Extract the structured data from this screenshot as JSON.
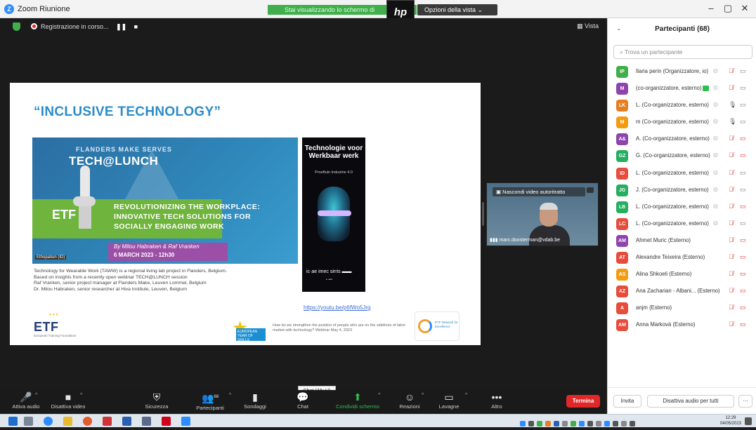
{
  "window": {
    "title": "Zoom Riunione",
    "share_banner": "Stai visualizzando lo schermo di",
    "view_options": "Opzioni della vista",
    "controls": [
      "–",
      "▢",
      "✕"
    ]
  },
  "meeting_top": {
    "recording": "Registrazione in corso...",
    "pause": "❚❚",
    "stop": "■",
    "view": "Vista"
  },
  "slide": {
    "title": "“INCLUSIVE TECHNOLOGY”",
    "banner_small": "FLANDERS MAKE SERVES",
    "banner_big": "TECH@LUNCH",
    "banner_headline": "REVOLUTIONIZING THE WORKPLACE: INNOVATIVE TECH SOLUTIONS FOR SOCIALLY ENGAGING WORK",
    "banner_authors": "By Milou Habraken & Raf Vranken",
    "banner_date": "6 MARCH 2023 - 12h30",
    "banner_tag": "Ethopation (ID)",
    "book_title": "Technologie voor Werkbaar werk",
    "book_sub": "Proeftuin Industrie 4.0",
    "book_logos": "ic·ae  imec  sirris  ▬▬",
    "link": "https://youtu.be/p6fWo5Jrg",
    "description": [
      "Technology for Wearable Work (TAWW) is a regional living lab project in Flanders, Belgium.",
      "Based on insights from a recently open webinar TECH@LUNCH session",
      "Raf Vranken, senior project manager at Flanders Make, Leuven Lommel, Belgium",
      "Dr. Milou Habraken, senior researcher at Hiva Institute, Leuven, Belgium"
    ],
    "etf": "ETF",
    "etf_sub": "European Training Foundation",
    "eys": "EUROPEAN YEAR OF SKILLS",
    "webinar": "How do we strengthen the position of people who are on the sidelines of labor market with technology? Webinar May 4, 2023",
    "network": "ETF Network for Excellence"
  },
  "camera": {
    "hide_label": "Nascondi video autoritratto",
    "participant_name": "marc.doosterman@vdab.be"
  },
  "tooltip": "Chat (Alt+H)",
  "toolbar": {
    "items": [
      {
        "label": "Attiva audio",
        "icon": "🎤"
      },
      {
        "label": "Disattiva video",
        "icon": "■"
      },
      {
        "label": "Sicurezza",
        "icon": "⛨"
      },
      {
        "label": "Partecipanti",
        "icon": "👥",
        "count": "68"
      },
      {
        "label": "Sondaggi",
        "icon": "▮"
      },
      {
        "label": "Chat",
        "icon": "💬"
      },
      {
        "label": "Condividi schermo",
        "icon": "⬆"
      },
      {
        "label": "Reazioni",
        "icon": "☺"
      },
      {
        "label": "Lavagne",
        "icon": "▭"
      },
      {
        "label": "Altro",
        "icon": "•••"
      }
    ],
    "end": "Termina"
  },
  "panel": {
    "title": "Partecipanti (68)",
    "search_placeholder": "Trova un partecipante",
    "participants": [
      {
        "initials": "IP",
        "color": "#3fae4b",
        "name": "Ilaria perin (Organizzatore, io)",
        "mic": "muted",
        "cam": "on"
      },
      {
        "initials": "M",
        "color": "#8e44ad",
        "name": "(co-organizzatore, esterno)",
        "mic": "muted",
        "cam": "on",
        "sharing": true
      },
      {
        "initials": "LK",
        "color": "#e67e22",
        "name": "L. (Co-organizzatore, esterno)",
        "mic": "on",
        "cam": "on"
      },
      {
        "initials": "M",
        "color": "#f39c12",
        "name": "m (Co-organizzatore, esterno)",
        "mic": "on",
        "cam": "on"
      },
      {
        "initials": "A&",
        "color": "#8e44ad",
        "name": "A. (Co-organizzatore, esterno)",
        "mic": "muted",
        "cam": "off"
      },
      {
        "initials": "GZ",
        "color": "#27ae60",
        "name": "G. (Co-organizzatore, esterno)",
        "mic": "muted",
        "cam": "off"
      },
      {
        "initials": "ID",
        "color": "#e74c3c",
        "name": "L. (Co-organizzatore, esterno)",
        "mic": "muted",
        "cam": "on"
      },
      {
        "initials": "JG",
        "color": "#27ae60",
        "name": "J. (Co-organizzatore, esterno)",
        "mic": "muted",
        "cam": "on"
      },
      {
        "initials": "LB",
        "color": "#27ae60",
        "name": "L. (Co-organizzatore, esterno)",
        "mic": "muted",
        "cam": "off"
      },
      {
        "initials": "LC",
        "color": "#e74c3c",
        "name": "L. (Co-organizzatore, esterno)",
        "mic": "muted",
        "cam": "on"
      },
      {
        "initials": "AM",
        "color": "#8e44ad",
        "name": "Ahmet Muric (Esterno)",
        "mic": "muted",
        "cam": "off"
      },
      {
        "initials": "AT",
        "color": "#e74c3c",
        "name": "Alexandre Teixeira (Esterno)",
        "mic": "muted",
        "cam": "off"
      },
      {
        "initials": "AS",
        "color": "#f39c12",
        "name": "Alina Shkoeli (Esterno)",
        "mic": "muted",
        "cam": "off"
      },
      {
        "initials": "AZ",
        "color": "#e74c3c",
        "name": "Ana Zacharian - Albani... (Esterno)",
        "mic": "muted",
        "cam": "off"
      },
      {
        "initials": "A",
        "color": "#e74c3c",
        "name": "anjm (Esterno)",
        "mic": "muted",
        "cam": "off"
      },
      {
        "initials": "AM",
        "color": "#e74c3c",
        "name": "Anna Marková (Esterno)",
        "mic": "muted",
        "cam": "off"
      }
    ],
    "footer": {
      "invite": "Invita",
      "mute_all": "Disattiva audio per tutti",
      "more": "···"
    }
  },
  "taskbar": {
    "time": "12:29",
    "date": "04/05/2023"
  }
}
